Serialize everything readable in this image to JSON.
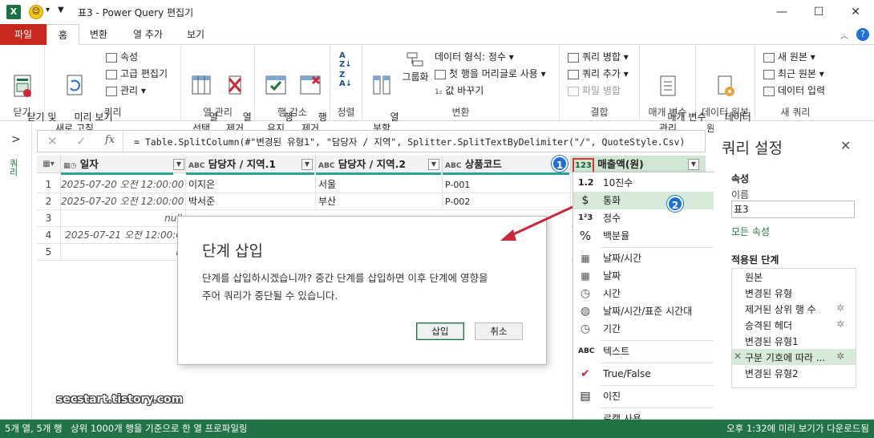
{
  "window": {
    "title": "표3 - Power Query 편집기",
    "minimize": "—",
    "maximize": "☐",
    "close": "✕",
    "qat_down": "▾"
  },
  "tabs": [
    "파일",
    "홈",
    "변환",
    "열 추가",
    "보기"
  ],
  "ribbon": {
    "close_btn": "닫기 및\n로드",
    "close_group": "닫기",
    "preview_btn": "미리 보기\n새로 고침",
    "props": "속성",
    "adv_editor": "고급 편집기",
    "manage": "관리",
    "query_group": "쿼리",
    "select_cols": "열\n선택",
    "remove_cols": "열\n제거",
    "col_group": "열 관리",
    "keep_rows": "행\n유지",
    "remove_rows": "행\n제거",
    "row_group": "행 감소",
    "sort_group": "정렬",
    "split_col": "열\n분할",
    "group_by": "그룹화",
    "data_type": "데이터 형식: 정수",
    "first_row": "첫 행을 머리글로 사용",
    "replace_values": "값 바꾸기",
    "transform_group": "변환",
    "merge_queries": "쿼리 병합",
    "append_queries": "쿼리 추가",
    "merge_files": "파일 병합",
    "combine_group": "결합",
    "manage_params": "매개 변수\n관리",
    "params_group": "매개 변수",
    "data_source": "데이터\n원본 설정",
    "source_group": "데이터 원본",
    "new_source": "새 원본",
    "recent_source": "최근 원본",
    "enter_data": "데이터 입력",
    "newquery_group": "새 쿼리"
  },
  "leftnav": {
    "label": "쿼리",
    "chevron": ">"
  },
  "formula": {
    "fx": "fx",
    "text": "= Table.SplitColumn(#\"변경된 유형1\", \"담당자 / 지역\", Splitter.SplitTextByDelimiter(\"/\", QuoteStyle.Csv)"
  },
  "table": {
    "columns": [
      {
        "type_icon": "ABC",
        "name": "일자"
      },
      {
        "type_icon": "ABC",
        "name": "담당자 / 지역.1"
      },
      {
        "type_icon": "ABC",
        "name": "담당자 / 지역.2"
      },
      {
        "type_icon": "ABC",
        "name": "상품코드"
      },
      {
        "type_icon": "123",
        "name": "매출액(원)"
      }
    ],
    "rows": [
      {
        "n": "1",
        "c1": "2025-07-20 오전 12:00:00",
        "c2": "이지은",
        "c3": "서울",
        "c4": "P-001",
        "c5": ""
      },
      {
        "n": "2",
        "c1": "2025-07-20 오전 12:00:00",
        "c2": "박서준",
        "c3": "부산",
        "c4": "P-002",
        "c5": ""
      },
      {
        "n": "3",
        "c1": "null",
        "c2": "",
        "c3": "",
        "c4": "",
        "c5": "null"
      },
      {
        "n": "4",
        "c1": "2025-07-21 오전 12:00:0",
        "c2": "",
        "c3": "",
        "c4": "",
        "c5": ""
      },
      {
        "n": "5",
        "c1": "n",
        "c2": "",
        "c3": "",
        "c4": "",
        "c5": "null"
      }
    ]
  },
  "type_menu": {
    "items": [
      {
        "icon": "1.2",
        "label": "10진수"
      },
      {
        "icon": "$",
        "label": "통화"
      },
      {
        "icon": "1²3",
        "label": "정수"
      },
      {
        "icon": "%",
        "label": "백분율"
      },
      {
        "icon": "▦",
        "label": "날짜/시간"
      },
      {
        "icon": "▦",
        "label": "날짜"
      },
      {
        "icon": "◷",
        "label": "시간"
      },
      {
        "icon": "◍",
        "label": "날짜/시간/표준 시간대"
      },
      {
        "icon": "◷",
        "label": "기간"
      },
      {
        "icon": "ABC",
        "label": "텍스트"
      },
      {
        "icon": "✔",
        "label": "True/False"
      },
      {
        "icon": "▤",
        "label": "이진"
      },
      {
        "icon": "",
        "label": "로캘 사용..."
      }
    ]
  },
  "dialog": {
    "title": "단계 삽입",
    "line1": "단계를 삽입하시겠습니까? 중간 단계를 삽입하면 이후 단계에 영향을",
    "line2": "주어 쿼리가 중단될 수 있습니다.",
    "insert": "삽입",
    "cancel": "취소"
  },
  "badges": {
    "one": "1",
    "two": "2"
  },
  "watermark": "secstart.tistory.com",
  "query_settings": {
    "title": "쿼리 설정",
    "close": "✕",
    "props_heading": "속성",
    "name_label": "이름",
    "name_value": "표3",
    "all_props": "모든 속성",
    "steps_heading": "적용된 단계",
    "steps": [
      {
        "label": "원본",
        "gear": ""
      },
      {
        "label": "변경된 유형",
        "gear": ""
      },
      {
        "label": "제거된 상위 행 수",
        "gear": "✲"
      },
      {
        "label": "승격된 헤더",
        "gear": "✲"
      },
      {
        "label": "변경된 유형1",
        "gear": ""
      },
      {
        "label": "구분 기호에 따라 ...",
        "gear": "✲"
      },
      {
        "label": "변경된 유형2",
        "gear": ""
      }
    ]
  },
  "status": {
    "left": "5개 열, 5개 행",
    "profile": "상위 1000개 행을 기준으로 한 열 프로파일링",
    "right": "오후 1:32에 미리 보기가 다운로드됨"
  },
  "colors": {
    "accent": "#217346",
    "file_tab": "#c7281e",
    "badge": "#1e6fd9",
    "highlight": "#d7ead9",
    "arrow": "#c8283a"
  }
}
